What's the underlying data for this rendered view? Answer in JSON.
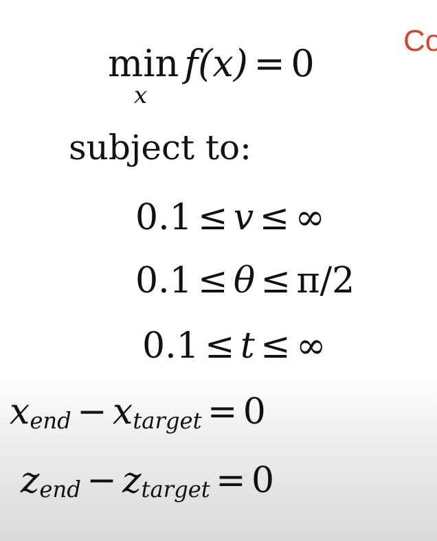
{
  "corner_label": "Co",
  "objective": {
    "min": "min",
    "variable": "x",
    "function": "f(x)",
    "equals": "=",
    "rhs": "0"
  },
  "subject_to": "subject to:",
  "constraints": [
    {
      "lower": "0.1",
      "le1": "≤",
      "var": "v",
      "le2": "≤",
      "upper": "∞"
    },
    {
      "lower": "0.1",
      "le1": "≤",
      "var": "θ",
      "le2": "≤",
      "upper": "π/2"
    },
    {
      "lower": "0.1",
      "le1": "≤",
      "var": "t",
      "le2": "≤",
      "upper": "∞"
    }
  ],
  "equalities": [
    {
      "a": "x",
      "a_sub": "end",
      "minus": "−",
      "b": "x",
      "b_sub": "target",
      "equals": "=",
      "rhs": "0"
    },
    {
      "a": "z",
      "a_sub": "end",
      "minus": "−",
      "b": "z",
      "b_sub": "target",
      "equals": "=",
      "rhs": "0"
    }
  ]
}
